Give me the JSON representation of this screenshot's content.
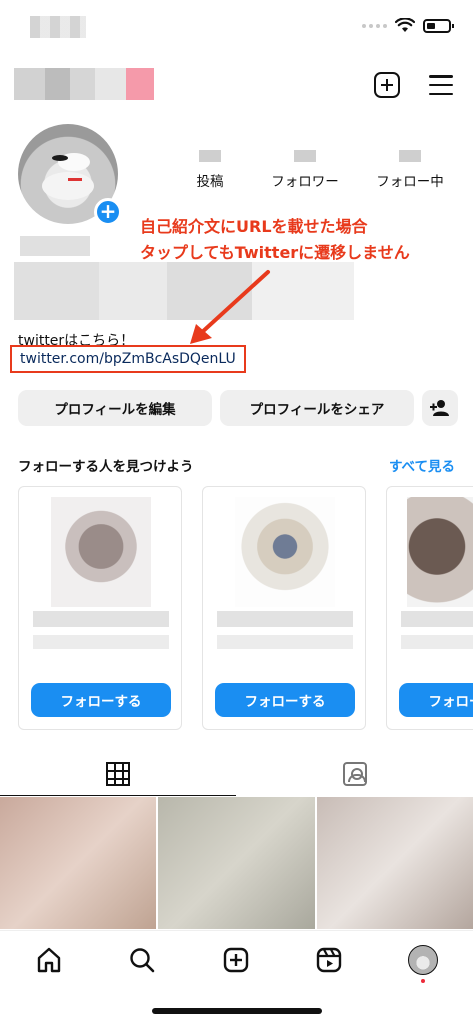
{
  "status_bar": {
    "icons": [
      "wifi-icon",
      "battery-icon"
    ]
  },
  "header": {
    "icons": [
      "new-post-icon",
      "menu-icon"
    ]
  },
  "profile": {
    "stats": [
      {
        "label": "投稿"
      },
      {
        "label": "フォロワー"
      },
      {
        "label": "フォロー中"
      }
    ],
    "bio_line": "twitterはこちら！",
    "bio_link": "twitter.com/bpZmBcAsDQenLU"
  },
  "annotation": {
    "line1": "自己紹介文にURLを載せた場合",
    "line2": "タップしてもTwitterに遷移しません",
    "color": "#e83a1c"
  },
  "actions": {
    "edit_label": "プロフィールを編集",
    "share_label": "プロフィールをシェア"
  },
  "suggestions": {
    "title": "フォローする人を見つけよう",
    "see_all": "すべて見る",
    "follow_label": "フォローする"
  },
  "tabs": [
    "grid-icon",
    "tagged-icon"
  ],
  "bottom_nav": [
    "home-icon",
    "search-icon",
    "create-icon",
    "reels-icon",
    "profile-avatar"
  ],
  "colors": {
    "accent": "#1a8ef2",
    "annotation": "#e83a1c"
  }
}
